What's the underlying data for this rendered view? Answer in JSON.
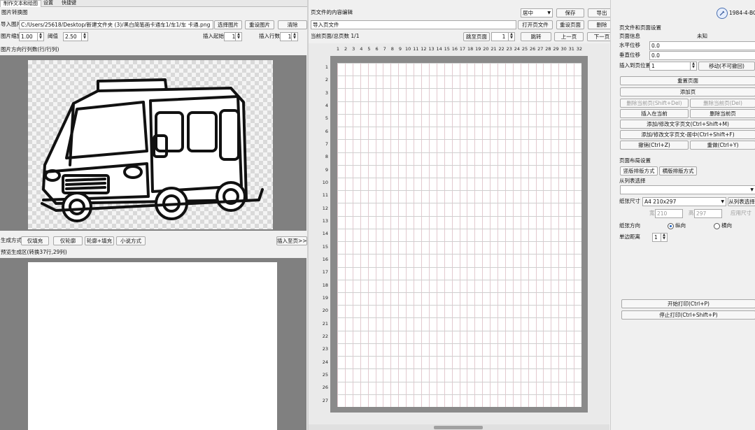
{
  "tabs": [
    "制作文本和绘图",
    "设置",
    "快捷键"
  ],
  "left": {
    "section_title": "图片转换图",
    "import_label": "导入图片",
    "path_value": "C:/Users/25618/Desktop/新建文件夹 (3)/黑白简笔画卡通车1/车1/车 卡通.png",
    "select_btn": "选择图片",
    "reset_btn": "重设图片",
    "clear_btn": "清除",
    "scale_label": "图片缩放",
    "scale_value": "1.00",
    "threshold_label": "阈值",
    "threshold_value": "2.50",
    "insert_start_label": "插入起始",
    "insert_start_value": "1",
    "insert_row_label": "插入行数",
    "insert_row_value": "1",
    "preview_title": "图片方向行列数(行/行列)",
    "mode_label": "生成方式",
    "mode_buttons": [
      "仅填充",
      "仅轮廓",
      "轮廓+填充",
      "小说方式"
    ],
    "insert_to_btn": "插入至页>>",
    "result_title": "预览生成区(转换37行,29列)"
  },
  "middle": {
    "section_title": "页文件的内容编辑",
    "alignment_value": "居中",
    "save_btn": "保存",
    "export_btn": "导出",
    "import_label": "导入页文件",
    "open_file_btn": "打开页文件",
    "reset_btn": "重设页面",
    "delete_btn": "删除",
    "page_info": "当前页面/总页数 1/1",
    "goto_label": "跳至页面",
    "goto_value": "1",
    "jump_btn": "跳转",
    "prev_btn": "上一页",
    "next_btn": "下一页",
    "ruler_cols": [
      "1",
      "2",
      "3",
      "4",
      "5",
      "6",
      "7",
      "8",
      "9",
      "10",
      "11",
      "12",
      "13",
      "14",
      "15",
      "16",
      "17",
      "18",
      "19",
      "20",
      "21",
      "22",
      "23",
      "24",
      "25",
      "26",
      "27",
      "28",
      "29",
      "30",
      "31",
      "32"
    ],
    "ruler_rows": [
      "1",
      "2",
      "3",
      "4",
      "5",
      "6",
      "7",
      "8",
      "9",
      "10",
      "11",
      "12",
      "13",
      "14",
      "15",
      "16",
      "17",
      "18",
      "19",
      "20",
      "21",
      "22",
      "23",
      "24",
      "25",
      "26",
      "27"
    ]
  },
  "right": {
    "app_id": "1984-4-BCD",
    "section_title": "页文件和页面设置",
    "file_label": "页面信息",
    "file_value": "未知",
    "row_count_label": "水平位移",
    "row_count_value": "0.0",
    "col_count_label": "垂直位移",
    "col_count_value": "0.0",
    "insert_label": "插入到页位置",
    "insert_value": "1",
    "move_btn": "移动(不可撤回)",
    "buttons": [
      "重置页面",
      "添加页",
      "删除当前页(Shift+Del)",
      "删除当前页(Del)",
      "插入在当前",
      "删除当前页",
      "添加/修改文字页文(Ctrl+Shift+M)",
      "添加/修改文字页文-居中(Ctrl+Shift+F)",
      "撤销(Ctrl+Z)",
      "重做(Ctrl+Y)"
    ],
    "page_settings_title": "页面布局设置",
    "mode_tabs": [
      "竖版排版方式",
      "横版排版方式"
    ],
    "paper_label": "纸张尺寸",
    "paper_value": "A4 210x297",
    "custom_btn": "从列表选择",
    "width_label": "宽",
    "width_value": "210",
    "height_label": "高",
    "height_value": "297",
    "apply_label": "应用尺寸",
    "orient_label": "纸张方向",
    "orient_options": [
      "纵向",
      "横向"
    ],
    "orient_selected": "纵向",
    "margin_label": "单边距离",
    "margin_value": "1",
    "print_btn": "开始打印(Ctrl+P)",
    "export_pdf_btn": "停止打印(Ctrl+Shift+P)"
  }
}
